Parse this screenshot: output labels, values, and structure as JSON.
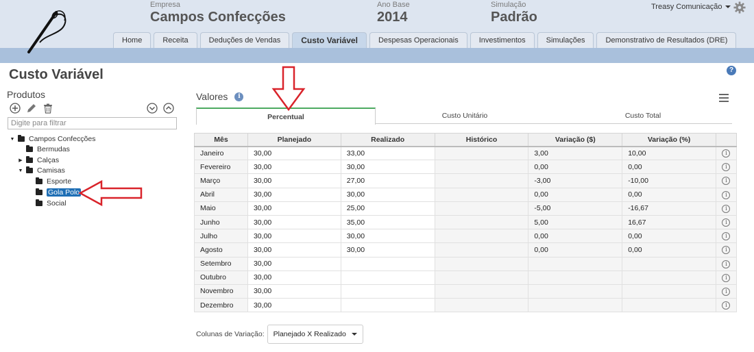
{
  "header": {
    "empresa": {
      "label": "Empresa",
      "value": "Campos Confecções"
    },
    "ano_base": {
      "label": "Ano Base",
      "value": "2014"
    },
    "simulacao": {
      "label": "Simulação",
      "value": "Padrão"
    },
    "user": "Treasy Comunicação",
    "tabs": [
      "Home",
      "Receita",
      "Deduções de Vendas",
      "Custo Variável",
      "Despesas Operacionais",
      "Investimentos",
      "Simulações",
      "Demonstrativo de Resultados (DRE)"
    ],
    "active_tab": "Custo Variável"
  },
  "page_title": "Custo Variável",
  "produtos": {
    "title": "Produtos",
    "filter_placeholder": "Digite para filtrar",
    "tree": [
      "Campos Confecções",
      "Bermudas",
      "Calças",
      "Camisas",
      "Esporte",
      "Gola Polo",
      "Social"
    ],
    "selected": "Gola Polo"
  },
  "valores": {
    "title": "Valores",
    "subtabs": [
      "Percentual",
      "Custo Unitário",
      "Custo Total"
    ],
    "active_subtab": "Percentual",
    "columns": [
      "Mês",
      "Planejado",
      "Realizado",
      "Histórico",
      "Variação ($)",
      "Variação (%)"
    ],
    "rows": [
      {
        "mes": "Janeiro",
        "planejado": "30,00",
        "realizado": "33,00",
        "historico": "",
        "var_abs": "3,00",
        "var_pct": "10,00",
        "sign": "pos"
      },
      {
        "mes": "Fevereiro",
        "planejado": "30,00",
        "realizado": "30,00",
        "historico": "",
        "var_abs": "0,00",
        "var_pct": "0,00",
        "sign": "zero"
      },
      {
        "mes": "Março",
        "planejado": "30,00",
        "realizado": "27,00",
        "historico": "",
        "var_abs": "-3,00",
        "var_pct": "-10,00",
        "sign": "neg"
      },
      {
        "mes": "Abril",
        "planejado": "30,00",
        "realizado": "30,00",
        "historico": "",
        "var_abs": "0,00",
        "var_pct": "0,00",
        "sign": "zero"
      },
      {
        "mes": "Maio",
        "planejado": "30,00",
        "realizado": "25,00",
        "historico": "",
        "var_abs": "-5,00",
        "var_pct": "-16,67",
        "sign": "neg"
      },
      {
        "mes": "Junho",
        "planejado": "30,00",
        "realizado": "35,00",
        "historico": "",
        "var_abs": "5,00",
        "var_pct": "16,67",
        "sign": "pos"
      },
      {
        "mes": "Julho",
        "planejado": "30,00",
        "realizado": "30,00",
        "historico": "",
        "var_abs": "0,00",
        "var_pct": "0,00",
        "sign": "zero"
      },
      {
        "mes": "Agosto",
        "planejado": "30,00",
        "realizado": "30,00",
        "historico": "",
        "var_abs": "0,00",
        "var_pct": "0,00",
        "sign": "zero"
      },
      {
        "mes": "Setembro",
        "planejado": "30,00",
        "realizado": "",
        "historico": "",
        "var_abs": "",
        "var_pct": "",
        "sign": "zero"
      },
      {
        "mes": "Outubro",
        "planejado": "30,00",
        "realizado": "",
        "historico": "",
        "var_abs": "",
        "var_pct": "",
        "sign": "zero"
      },
      {
        "mes": "Novembro",
        "planejado": "30,00",
        "realizado": "",
        "historico": "",
        "var_abs": "",
        "var_pct": "",
        "sign": "zero"
      },
      {
        "mes": "Dezembro",
        "planejado": "30,00",
        "realizado": "",
        "historico": "",
        "var_abs": "",
        "var_pct": "",
        "sign": "zero"
      }
    ]
  },
  "colunas_variacao": {
    "label": "Colunas de Variação:",
    "selected": "Planejado X Realizado"
  },
  "colors": {
    "header_bg": "#dde5f0",
    "band": "#a9c0dc",
    "positive_variation": "#cc2b2b",
    "negative_variation": "#3a8a2d",
    "active_subtab_border": "#4caa60",
    "selection": "#1f6fb5",
    "annotation_arrow": "#d9232a"
  }
}
